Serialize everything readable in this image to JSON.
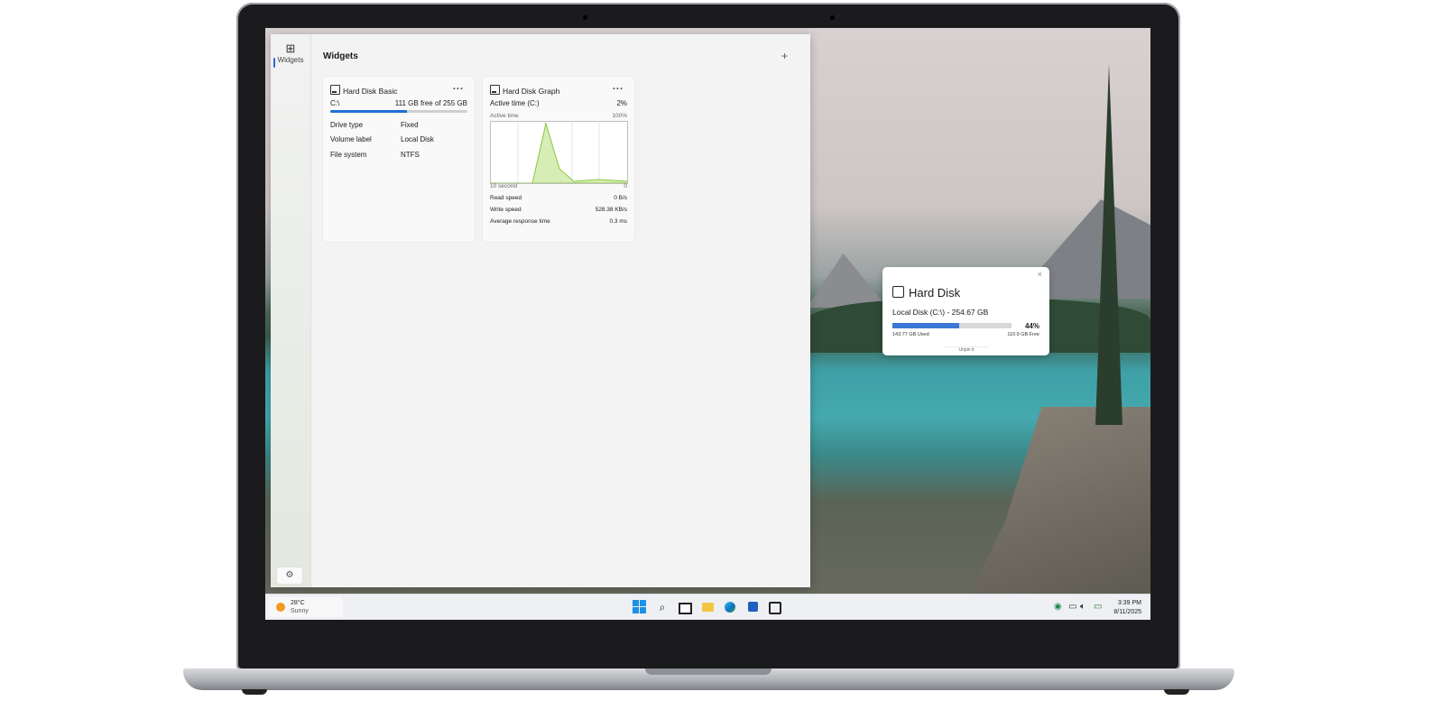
{
  "widgets_window": {
    "title": "Widgets",
    "rail_label": "Widgets",
    "add_icon": "plus-icon",
    "settings_icon": "gear-icon"
  },
  "hd_basic": {
    "title": "Hard Disk Basic",
    "menu": "...",
    "drive": "C:\\",
    "free_text": "111 GB free of 255 GB",
    "used_fraction": 0.56,
    "rows": [
      {
        "label": "Drive type",
        "value": "Fixed"
      },
      {
        "label": "Volume label",
        "value": "Local Disk"
      },
      {
        "label": "File system",
        "value": "NTFS"
      }
    ]
  },
  "hd_graph": {
    "title": "Hard Disk Graph",
    "menu": "...",
    "active_label": "Active time (C:)",
    "active_value": "2%",
    "graph_label": "Active time",
    "graph_max": "100%",
    "graph_left": "10 second",
    "graph_right": "0",
    "stats": [
      {
        "label": "Read speed",
        "value": "0 B/s"
      },
      {
        "label": "Write speed",
        "value": "528.38 KB/s"
      },
      {
        "label": "Average response time",
        "value": "0.3 ms"
      }
    ]
  },
  "popup": {
    "title": "Hard Disk",
    "subtitle": "Local Disk (C:\\) - 254.67 GB",
    "percent": "44%",
    "used_fraction": 0.56,
    "used": "143.77 GB Used",
    "free": "110.9 GB Free",
    "unpin": "Unpin it",
    "close": "×"
  },
  "taskbar": {
    "temperature": "28°C",
    "condition": "Sunny",
    "time": "3:39 PM",
    "date": "8/11/2025",
    "icons": [
      "windows-start-icon",
      "search-icon",
      "task-view-icon",
      "file-explorer-icon",
      "edge-icon",
      "store-icon",
      "hard-disk-app-icon"
    ]
  },
  "colors": {
    "accent": "#1f6fd1",
    "popup_bar": "#3978d4",
    "graph_line": "#8cc63f"
  }
}
